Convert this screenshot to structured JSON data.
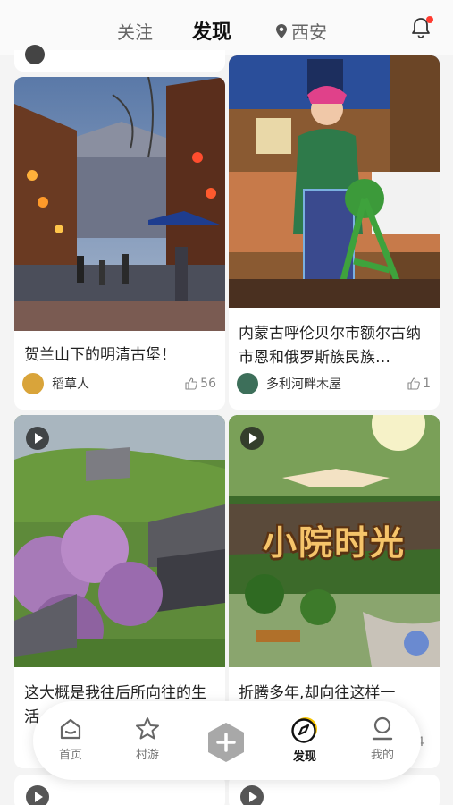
{
  "header": {
    "tabs": [
      {
        "label": "关注"
      },
      {
        "label": "发现"
      },
      {
        "label": "西安"
      }
    ],
    "active_tab": "发现"
  },
  "feed": {
    "cards": [
      {
        "title": "贺兰山下的明清古堡！",
        "author": "稻草人",
        "likes": "56",
        "is_video": false
      },
      {
        "title": "内蒙古呼伦贝尔市额尔古纳市恩和俄罗斯族民族…",
        "author": "多利河畔木屋",
        "likes": "1",
        "is_video": false
      },
      {
        "title": "这大概是我往后所向往的生活",
        "author": "",
        "likes": "",
        "is_video": true
      },
      {
        "title": "折腾多年,却向往这样一",
        "author": "",
        "likes": "4",
        "is_video": true,
        "overlay_text": "小院时光"
      }
    ]
  },
  "bottom_nav": {
    "items": [
      {
        "label": "首页",
        "icon": "home-icon"
      },
      {
        "label": "村游",
        "icon": "star-icon"
      },
      {
        "label": "",
        "icon": "plus-icon"
      },
      {
        "label": "发现",
        "icon": "compass-icon"
      },
      {
        "label": "我的",
        "icon": "profile-icon"
      }
    ],
    "active": "发现"
  },
  "colors": {
    "accent": "#f5c400",
    "notification_dot": "#ff3b30",
    "text_primary": "#111111",
    "text_secondary": "#777777"
  }
}
